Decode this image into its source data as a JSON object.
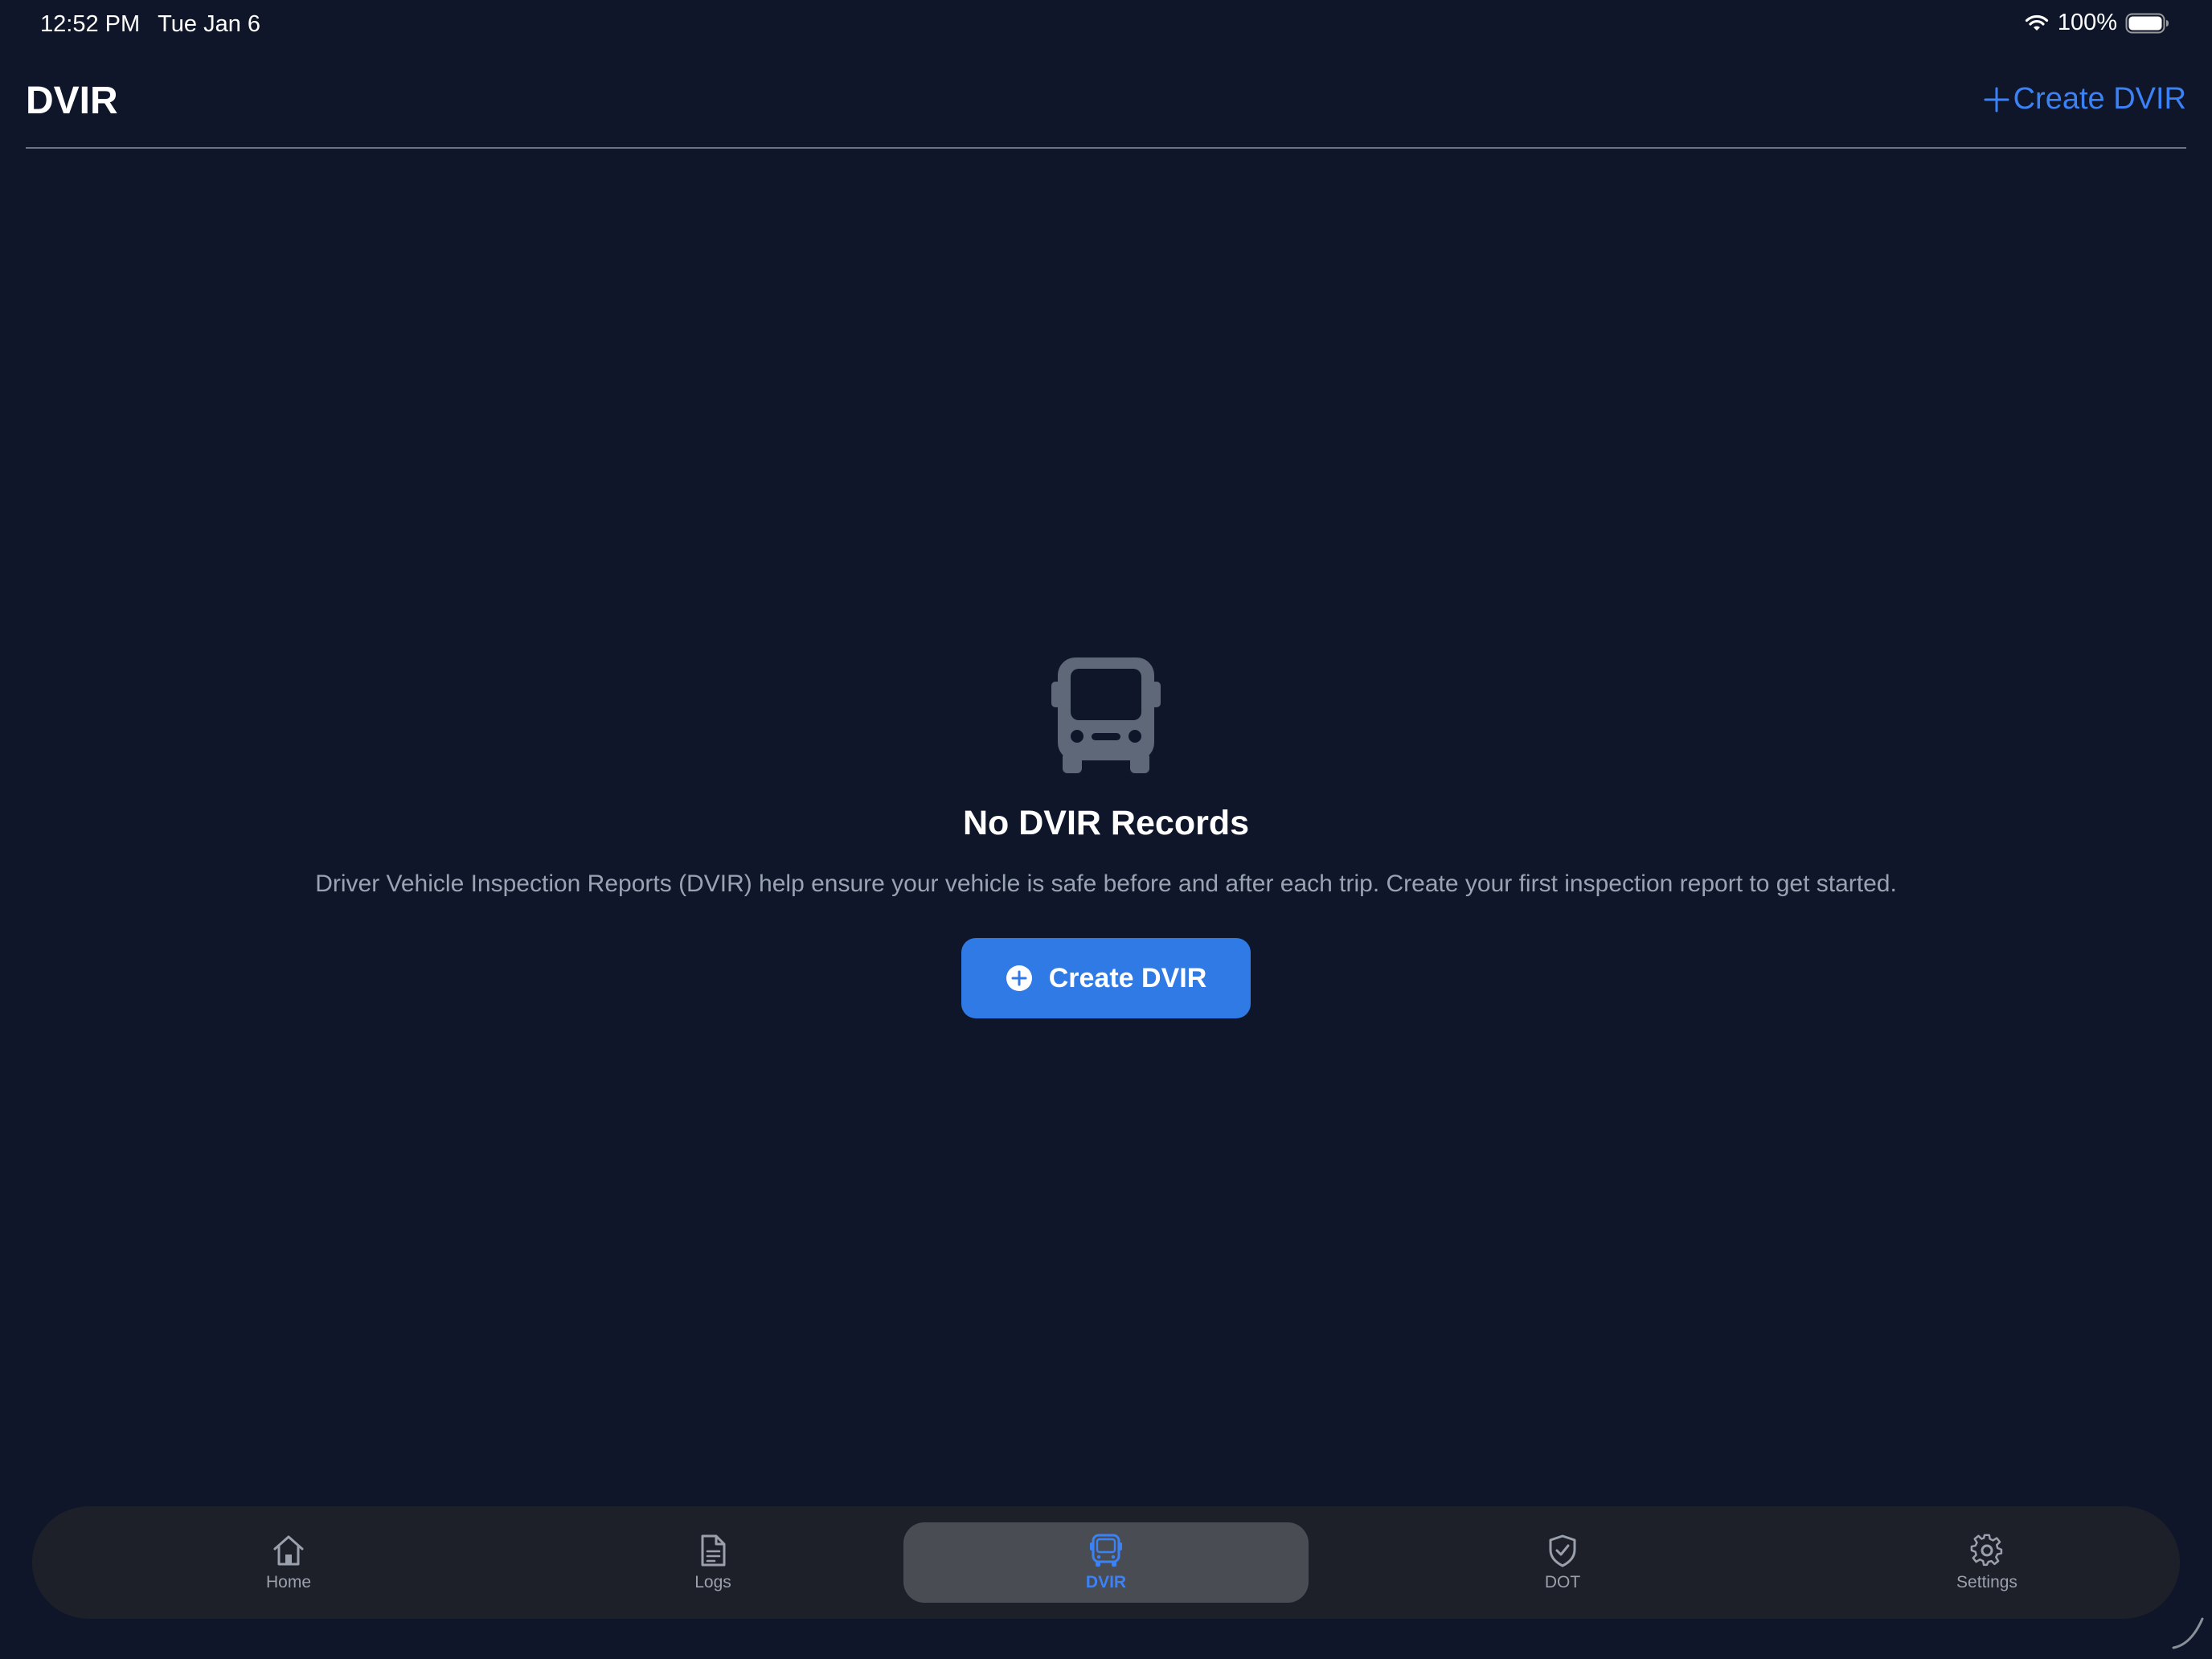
{
  "status_bar": {
    "time": "12:52 PM",
    "date": "Tue Jan 6",
    "battery": "100%"
  },
  "header": {
    "title": "DVIR",
    "create_label": "Create DVIR"
  },
  "empty_state": {
    "icon": "bus-icon",
    "title": "No DVIR Records",
    "description": "Driver Vehicle Inspection Reports (DVIR) help ensure your vehicle is safe before and after each trip. Create your first inspection report to get started.",
    "button_label": "Create DVIR"
  },
  "tabs": [
    {
      "label": "Home",
      "icon": "home-icon",
      "active": false
    },
    {
      "label": "Logs",
      "icon": "document-icon",
      "active": false
    },
    {
      "label": "DVIR",
      "icon": "bus-icon",
      "active": true
    },
    {
      "label": "DOT",
      "icon": "shield-check-icon",
      "active": false
    },
    {
      "label": "Settings",
      "icon": "gear-icon",
      "active": false
    }
  ],
  "colors": {
    "background": "#0f1629",
    "accent": "#3b82f6",
    "button": "#2f7ae5",
    "tab_bar": "#1e2029",
    "tab_active": "#4a4c53",
    "muted_text": "#9aa3b2"
  }
}
